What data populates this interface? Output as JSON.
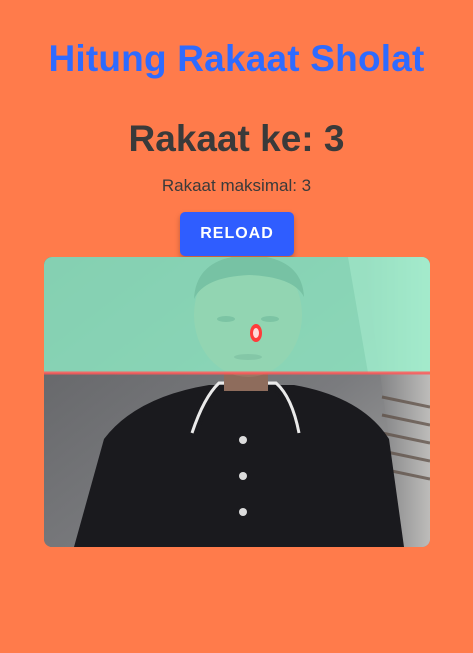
{
  "app": {
    "title": "Hitung Rakaat Sholat"
  },
  "counter": {
    "current_label": "Rakaat ke: 3",
    "max_label": "Rakaat maksimal: 3"
  },
  "actions": {
    "reload_label": "RELOAD"
  },
  "camera": {
    "overlay_color": "#8ff0c8",
    "threshold_line_color": "#ff5a5a",
    "nose_marker_color": "#ff3b3b"
  },
  "colors": {
    "background": "#ff7b4b",
    "title": "#2e6bff",
    "button": "#2f5dff",
    "text": "#3a3a3a"
  }
}
